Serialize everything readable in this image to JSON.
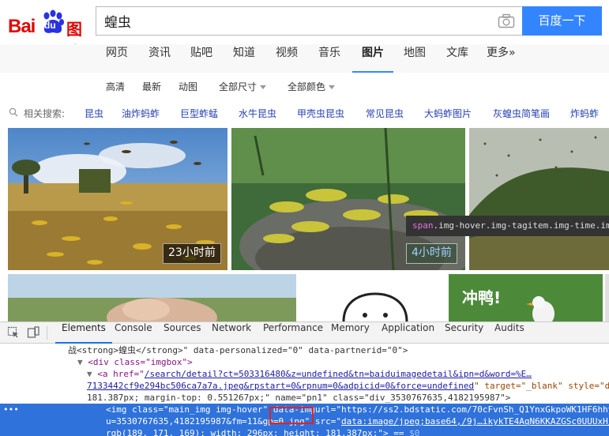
{
  "logo": {
    "bai": "Bai",
    "du": "du",
    "tupian": "图片"
  },
  "search": {
    "query": "蝗虫",
    "button": "百度一下"
  },
  "nav": [
    "网页",
    "资讯",
    "贴吧",
    "知道",
    "视频",
    "音乐",
    "图片",
    "地图",
    "文库",
    "更多»"
  ],
  "nav_active": "图片",
  "filters": {
    "hd": "高清",
    "latest": "最新",
    "animated": "动图",
    "size": "全部尺寸",
    "color": "全部颜色"
  },
  "related": {
    "label": "相关搜索:",
    "items": [
      "昆虫",
      "油炸蚂蚱",
      "巨型蚱蜢",
      "水牛昆虫",
      "甲壳虫昆虫",
      "常见昆虫",
      "大蚂蚱图片",
      "灰蝗虫简笔画",
      "炸蚂蚱"
    ]
  },
  "images": {
    "badge1": "23小时前",
    "badge2": "4小时前",
    "tooltip_tag": "span",
    "tooltip_rest": ".img-hover.img-tagitem.img-time.im",
    "sticker_text": "冲鸭!"
  },
  "devtools": {
    "tabs": [
      "Elements",
      "Console",
      "Sources",
      "Network",
      "Performance",
      "Memory",
      "Application",
      "Security",
      "Audits"
    ],
    "active_tab": "Elements",
    "lines": {
      "l1": "战<strong>蝗虫</strong>\" data-personalized=\"0\" data-partnerid=\"0\">",
      "l2_tag": "<div class=\"imgbox\">",
      "l3_a": "<a href=\"",
      "l3_href": "/search/detail?ct=503316480&z=undefined&tn=baiduimagedetail&ipn=d&word=%E…",
      "l4_href": "7133442cf9e294bc506ca7a7a.jpeg&rpstart=0&rpnum=0&adpicid=0&force=undefined",
      "l4_rest": "\" target=\"_blank\" style=\"d",
      "l5": "181.387px; margin-top: 0.551267px;\" name=\"pn1\" class=\"div_3530767635,4182195987\">",
      "l6": "<img class=\"main_img img-hover\" data-imgurl=\"https://ss2.bdstatic.com/70cFvnSh_Q1YnxGkpoWK1HF6hhy",
      "l7a": "u=3530767635,4182195987&fm=11&gp",
      "l7b": "=0.jpg",
      "l7c": "\" src=\"",
      "l7d": "data:image/jpeg;base64,/9j…ikykTE4AqN6KKAZGSc0UUUxH/",
      "l8": "rgb(189, 171, 169); width: 296px; height: 181.387px;\"> == ",
      "l8_dollar": "$0",
      "dots": "•••"
    }
  },
  "colors": {
    "brand_red": "#e10602",
    "brand_blue": "#3385ff",
    "link_blue": "#2440b3",
    "selection": "#2f72db"
  }
}
